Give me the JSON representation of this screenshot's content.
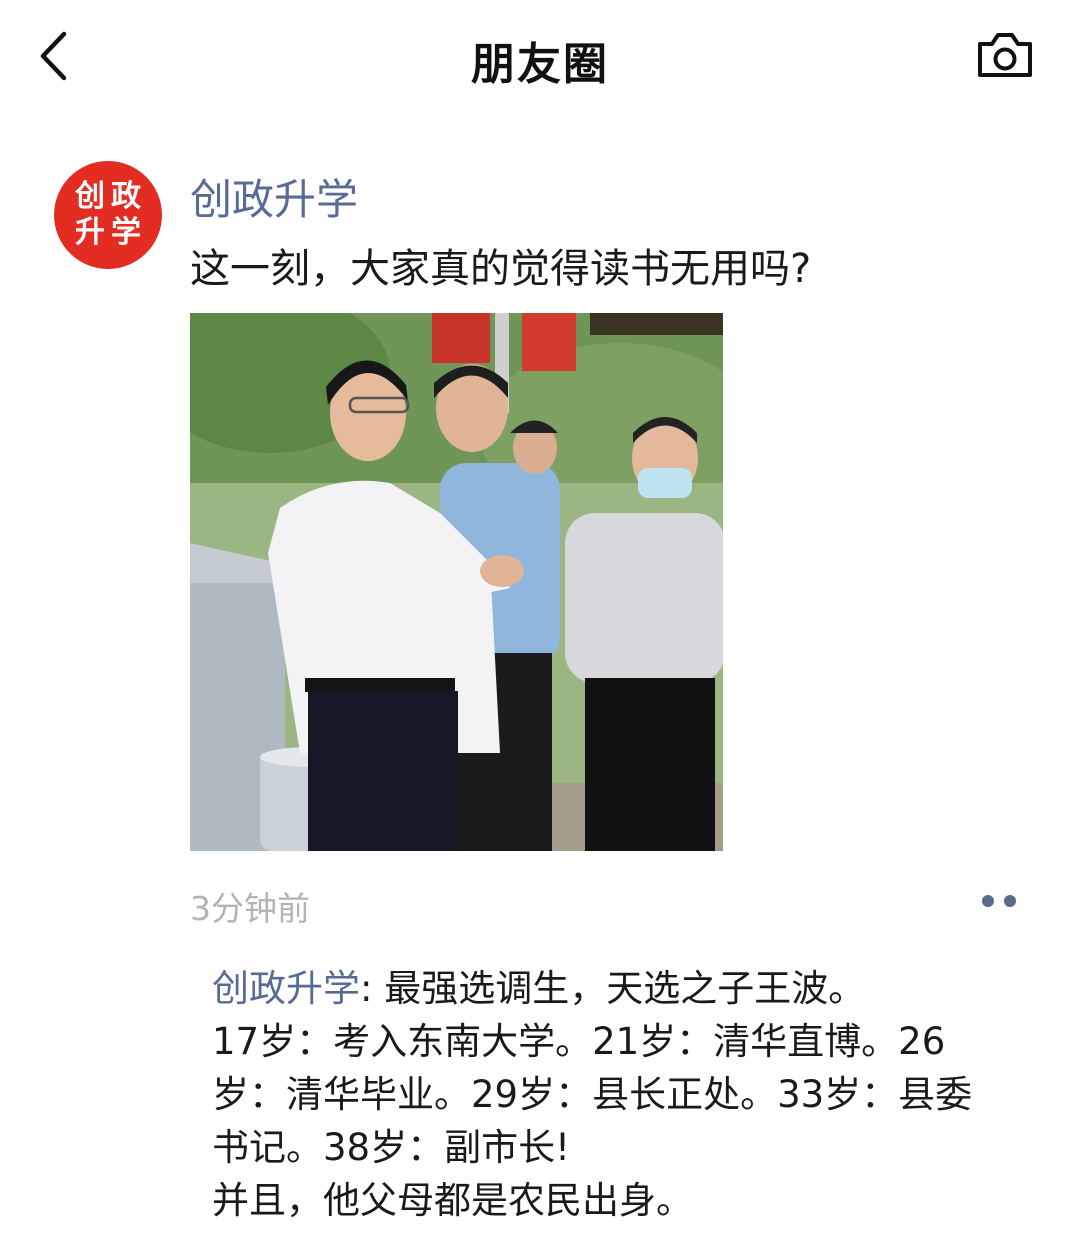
{
  "header": {
    "title": "朋友圈",
    "back_icon": "chevron-left-icon",
    "camera_icon": "camera-icon"
  },
  "post": {
    "avatar_text": [
      "创",
      "政",
      "升",
      "学"
    ],
    "avatar_color": "#e32d22",
    "author": "创政升学",
    "caption": "这一刻，大家真的觉得读书无用吗?",
    "time": "3分钟前",
    "more_icon": "more-dots-icon"
  },
  "comment": {
    "author": "创政升学",
    "separator": ": ",
    "lines": [
      "最强选调生，天选之子王波。",
      "17岁：考入东南大学。21岁：清华直博。26",
      "岁：清华毕业。29岁：县长正处。33岁：县委",
      "书记。38岁：副市长!",
      "并且，他父母都是农民出身。"
    ]
  },
  "colors": {
    "name_link": "#576b95",
    "time_gray": "#b3b3b3",
    "text": "#1a1a1a"
  }
}
